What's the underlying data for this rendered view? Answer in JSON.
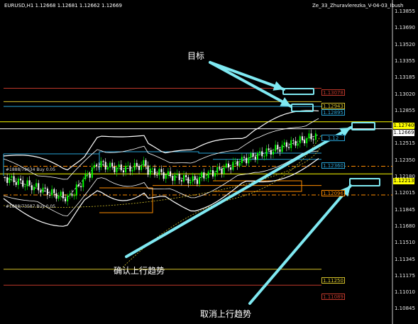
{
  "header": {
    "symbol_info": "EURUSD,H1  1.12668 1.12681 1.12662 1.12669",
    "indicator_name": "Ze_33_Zhuravlerezka_V-04-03_Ibush"
  },
  "price_axis": [
    "1.13855",
    "1.13690",
    "1.13520",
    "1.13355",
    "1.13185",
    "1.13020",
    "1.12855",
    "1.12685",
    "1.12515",
    "1.12350",
    "1.12180",
    "1.12015",
    "1.11845",
    "1.11680",
    "1.11510",
    "1.11345",
    "1.11175",
    "1.11010",
    "1.10845"
  ],
  "price_boxes": {
    "p13078": "1.13078",
    "p12943": "1.12943",
    "p12895": "1.12895",
    "p12740": "1.12740",
    "p12669": "1.12669",
    "p12360": "1.12360",
    "p12213": "1.12213",
    "p12096": "1.12096",
    "p11250": "1.11250",
    "p11089": "1.11089",
    "p12_partial": "1.12"
  },
  "level_labels": {
    "upper": "#1888/79634 Buy 0.05",
    "lower": "#1888/73587 Buy 0.05"
  },
  "annotations": {
    "target": "目标",
    "confirm_uptrend": "确认上行趋势",
    "cancel_uptrend": "取消上行趋势"
  },
  "colors": {
    "background": "#000000",
    "bull_candle": "#00ff00",
    "bear_candle": "#ffffff",
    "bands": "#ffffff",
    "arrow": "#7fe9f2",
    "resistance": "#c0392b",
    "support_gold": "#d4c12a",
    "support_orange": "#ff8c00",
    "current_price": "#ffff00"
  }
}
